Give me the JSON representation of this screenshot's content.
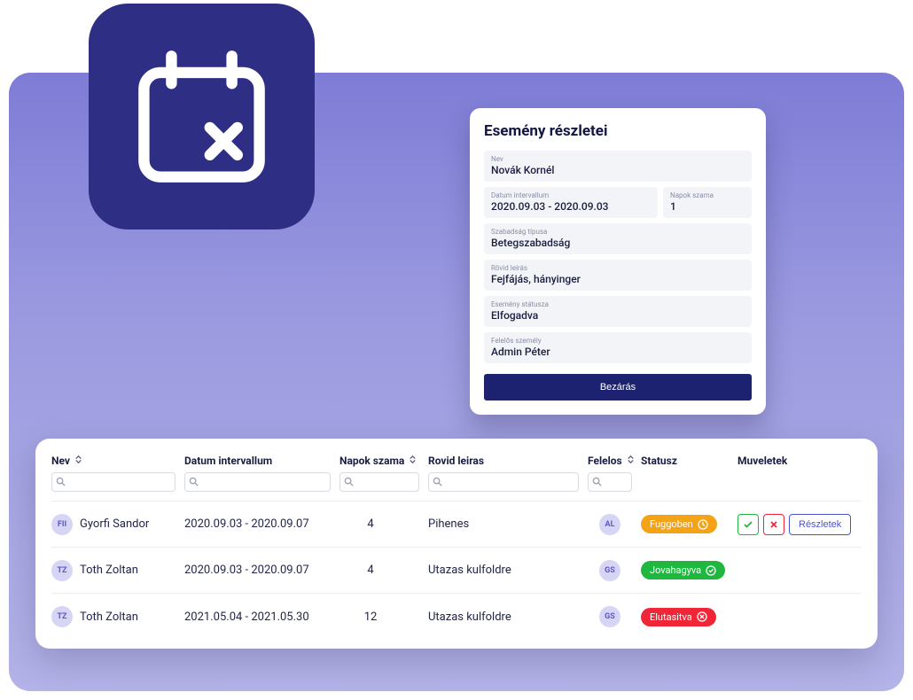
{
  "details": {
    "title": "Esemény részletei",
    "fields": {
      "nev_label": "Nev",
      "nev_value": "Novák Kornél",
      "datum_label": "Datum intervallum",
      "datum_value": "2020.09.03 - 2020.09.03",
      "napok_label": "Napok szama",
      "napok_value": "1",
      "tipus_label": "Szabadság típusa",
      "tipus_value": "Betegszabadság",
      "leiras_label": "Rövid leírás",
      "leiras_value": "Fejfájás, hányinger",
      "statusz_label": "Esemény státusza",
      "statusz_value": "Elfogadva",
      "felelos_label": "Felelős személy",
      "felelos_value": "Admin Péter"
    },
    "close_label": "Bezárás"
  },
  "table": {
    "headers": {
      "nev": "Nev",
      "datum": "Datum intervallum",
      "napok": "Napok szama",
      "rovid": "Rovid leiras",
      "felelos": "Felelos",
      "statusz": "Statusz",
      "muveletek": "Muveletek"
    },
    "rows": [
      {
        "avatar": "FII",
        "nev": "Gyorfi Sandor",
        "datum": "2020.09.03 - 2020.09.07",
        "napok": "4",
        "rovid": "Pihenes",
        "felelos": "AL",
        "statusz": "Fuggoben",
        "statusz_class": "badge-pending",
        "actions": true
      },
      {
        "avatar": "TZ",
        "nev": "Toth Zoltan",
        "datum": "2020.09.03 - 2020.09.07",
        "napok": "4",
        "rovid": "Utazas kulfoldre",
        "felelos": "GS",
        "statusz": "Jovahagyva",
        "statusz_class": "badge-approved",
        "actions": false
      },
      {
        "avatar": "TZ",
        "nev": "Toth Zoltan",
        "datum": "2021.05.04 - 2021.05.30",
        "napok": "12",
        "rovid": "Utazas kulfoldre",
        "felelos": "GS",
        "statusz": "Elutasitva",
        "statusz_class": "badge-rejected",
        "actions": false
      }
    ],
    "actions": {
      "details_label": "Részletek"
    }
  }
}
